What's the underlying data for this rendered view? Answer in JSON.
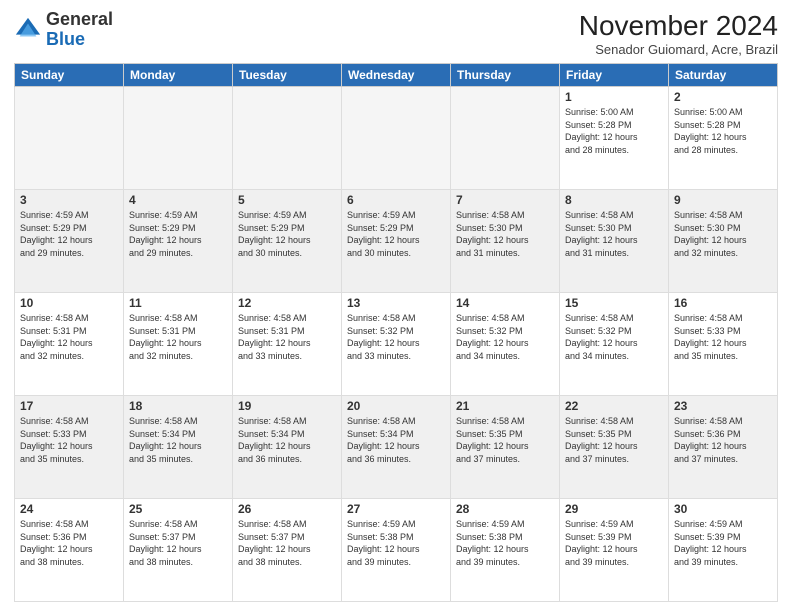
{
  "header": {
    "logo_line1": "General",
    "logo_line2": "Blue",
    "month": "November 2024",
    "location": "Senador Guiomard, Acre, Brazil"
  },
  "days_of_week": [
    "Sunday",
    "Monday",
    "Tuesday",
    "Wednesday",
    "Thursday",
    "Friday",
    "Saturday"
  ],
  "weeks": [
    [
      {
        "day": "",
        "text": "",
        "empty": true
      },
      {
        "day": "",
        "text": "",
        "empty": true
      },
      {
        "day": "",
        "text": "",
        "empty": true
      },
      {
        "day": "",
        "text": "",
        "empty": true
      },
      {
        "day": "",
        "text": "",
        "empty": true
      },
      {
        "day": "1",
        "text": "Sunrise: 5:00 AM\nSunset: 5:28 PM\nDaylight: 12 hours\nand 28 minutes."
      },
      {
        "day": "2",
        "text": "Sunrise: 5:00 AM\nSunset: 5:28 PM\nDaylight: 12 hours\nand 28 minutes."
      }
    ],
    [
      {
        "day": "3",
        "text": "Sunrise: 4:59 AM\nSunset: 5:29 PM\nDaylight: 12 hours\nand 29 minutes.",
        "shade": true
      },
      {
        "day": "4",
        "text": "Sunrise: 4:59 AM\nSunset: 5:29 PM\nDaylight: 12 hours\nand 29 minutes.",
        "shade": true
      },
      {
        "day": "5",
        "text": "Sunrise: 4:59 AM\nSunset: 5:29 PM\nDaylight: 12 hours\nand 30 minutes.",
        "shade": true
      },
      {
        "day": "6",
        "text": "Sunrise: 4:59 AM\nSunset: 5:29 PM\nDaylight: 12 hours\nand 30 minutes.",
        "shade": true
      },
      {
        "day": "7",
        "text": "Sunrise: 4:58 AM\nSunset: 5:30 PM\nDaylight: 12 hours\nand 31 minutes.",
        "shade": true
      },
      {
        "day": "8",
        "text": "Sunrise: 4:58 AM\nSunset: 5:30 PM\nDaylight: 12 hours\nand 31 minutes.",
        "shade": true
      },
      {
        "day": "9",
        "text": "Sunrise: 4:58 AM\nSunset: 5:30 PM\nDaylight: 12 hours\nand 32 minutes.",
        "shade": true
      }
    ],
    [
      {
        "day": "10",
        "text": "Sunrise: 4:58 AM\nSunset: 5:31 PM\nDaylight: 12 hours\nand 32 minutes."
      },
      {
        "day": "11",
        "text": "Sunrise: 4:58 AM\nSunset: 5:31 PM\nDaylight: 12 hours\nand 32 minutes."
      },
      {
        "day": "12",
        "text": "Sunrise: 4:58 AM\nSunset: 5:31 PM\nDaylight: 12 hours\nand 33 minutes."
      },
      {
        "day": "13",
        "text": "Sunrise: 4:58 AM\nSunset: 5:32 PM\nDaylight: 12 hours\nand 33 minutes."
      },
      {
        "day": "14",
        "text": "Sunrise: 4:58 AM\nSunset: 5:32 PM\nDaylight: 12 hours\nand 34 minutes."
      },
      {
        "day": "15",
        "text": "Sunrise: 4:58 AM\nSunset: 5:32 PM\nDaylight: 12 hours\nand 34 minutes."
      },
      {
        "day": "16",
        "text": "Sunrise: 4:58 AM\nSunset: 5:33 PM\nDaylight: 12 hours\nand 35 minutes."
      }
    ],
    [
      {
        "day": "17",
        "text": "Sunrise: 4:58 AM\nSunset: 5:33 PM\nDaylight: 12 hours\nand 35 minutes.",
        "shade": true
      },
      {
        "day": "18",
        "text": "Sunrise: 4:58 AM\nSunset: 5:34 PM\nDaylight: 12 hours\nand 35 minutes.",
        "shade": true
      },
      {
        "day": "19",
        "text": "Sunrise: 4:58 AM\nSunset: 5:34 PM\nDaylight: 12 hours\nand 36 minutes.",
        "shade": true
      },
      {
        "day": "20",
        "text": "Sunrise: 4:58 AM\nSunset: 5:34 PM\nDaylight: 12 hours\nand 36 minutes.",
        "shade": true
      },
      {
        "day": "21",
        "text": "Sunrise: 4:58 AM\nSunset: 5:35 PM\nDaylight: 12 hours\nand 37 minutes.",
        "shade": true
      },
      {
        "day": "22",
        "text": "Sunrise: 4:58 AM\nSunset: 5:35 PM\nDaylight: 12 hours\nand 37 minutes.",
        "shade": true
      },
      {
        "day": "23",
        "text": "Sunrise: 4:58 AM\nSunset: 5:36 PM\nDaylight: 12 hours\nand 37 minutes.",
        "shade": true
      }
    ],
    [
      {
        "day": "24",
        "text": "Sunrise: 4:58 AM\nSunset: 5:36 PM\nDaylight: 12 hours\nand 38 minutes."
      },
      {
        "day": "25",
        "text": "Sunrise: 4:58 AM\nSunset: 5:37 PM\nDaylight: 12 hours\nand 38 minutes."
      },
      {
        "day": "26",
        "text": "Sunrise: 4:58 AM\nSunset: 5:37 PM\nDaylight: 12 hours\nand 38 minutes."
      },
      {
        "day": "27",
        "text": "Sunrise: 4:59 AM\nSunset: 5:38 PM\nDaylight: 12 hours\nand 39 minutes."
      },
      {
        "day": "28",
        "text": "Sunrise: 4:59 AM\nSunset: 5:38 PM\nDaylight: 12 hours\nand 39 minutes."
      },
      {
        "day": "29",
        "text": "Sunrise: 4:59 AM\nSunset: 5:39 PM\nDaylight: 12 hours\nand 39 minutes."
      },
      {
        "day": "30",
        "text": "Sunrise: 4:59 AM\nSunset: 5:39 PM\nDaylight: 12 hours\nand 39 minutes."
      }
    ]
  ]
}
